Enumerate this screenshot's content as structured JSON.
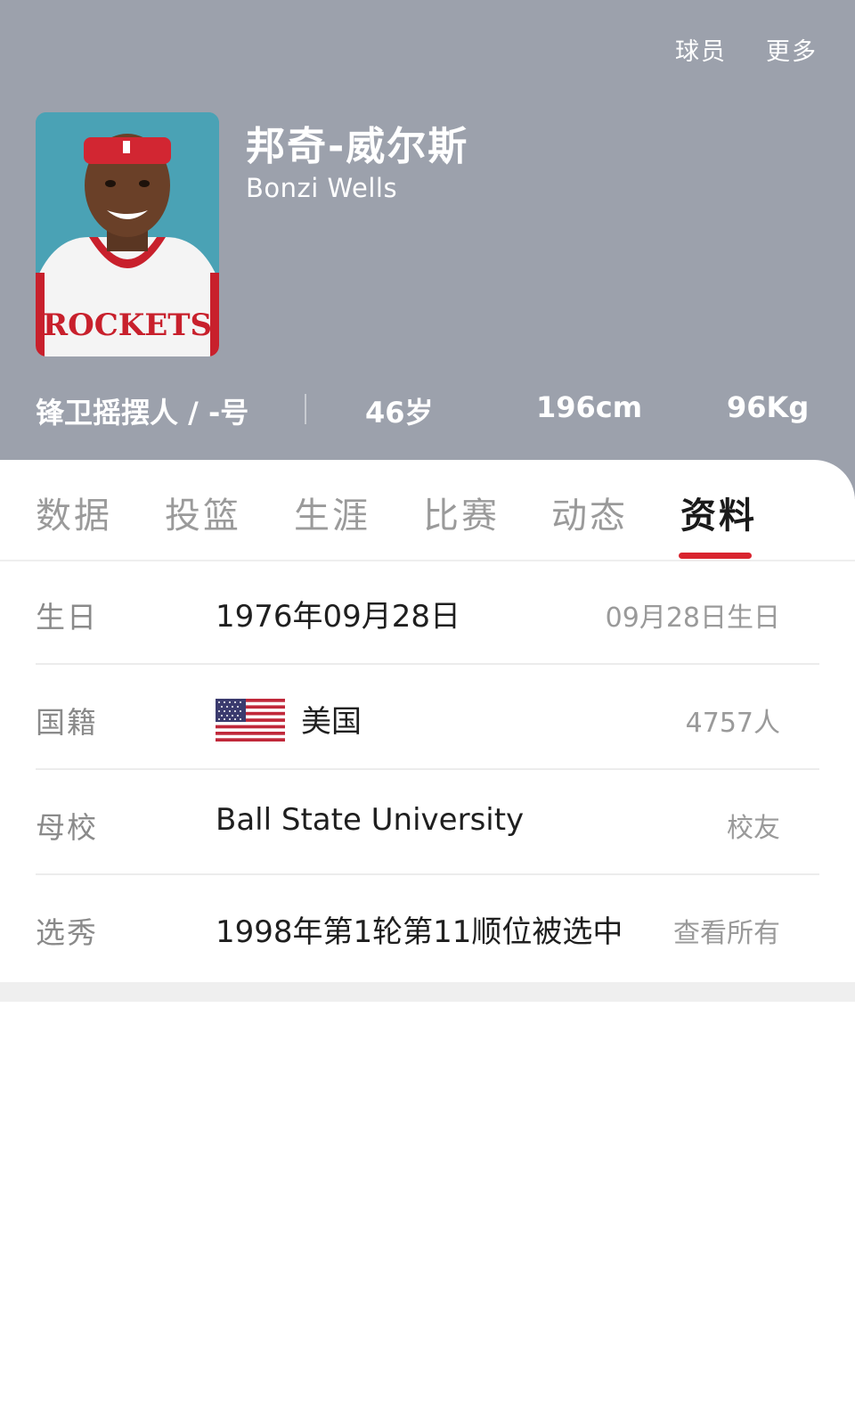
{
  "header": {
    "actions": [
      "球员",
      "更多"
    ],
    "name_cn": "邦奇-威尔斯",
    "name_en": "Bonzi Wells",
    "position": "锋卫摇摆人 / -号",
    "age": "46岁",
    "height": "196cm",
    "weight": "96Kg",
    "background_color": "#9ca1ac",
    "jersey_text": "ROCKETS"
  },
  "tabs": {
    "items": [
      "数据",
      "投篮",
      "生涯",
      "比赛",
      "动态",
      "资料"
    ],
    "active": "资料",
    "indicator_color": "#d9242f"
  },
  "profile": {
    "birthday": {
      "label": "生日",
      "value": "1976年09月28日",
      "extra": "09月28日生日"
    },
    "nationality": {
      "label": "国籍",
      "value": "美国",
      "extra": "4757人",
      "flag_icon": "us-flag-icon"
    },
    "college": {
      "label": "母校",
      "value": "Ball State University",
      "extra": "校友"
    },
    "draft": {
      "label": "选秀",
      "value": "1998年第1轮第11顺位被选中",
      "extra": "查看所有"
    }
  }
}
